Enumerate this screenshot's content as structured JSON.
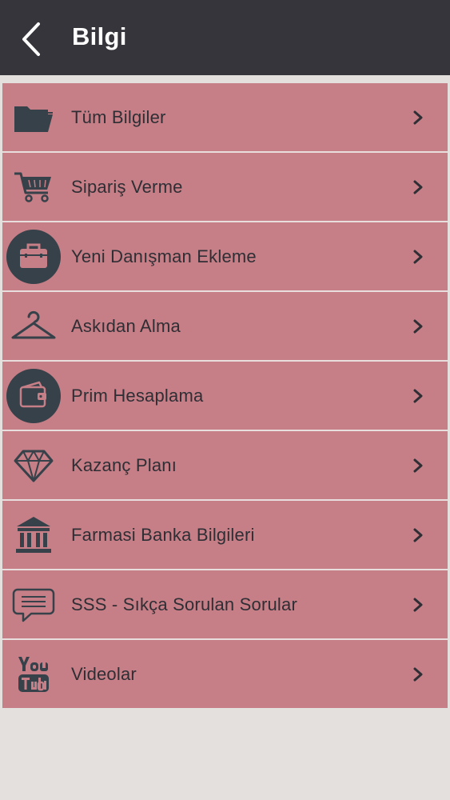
{
  "header": {
    "title": "Bilgi",
    "background": "#36353c"
  },
  "menu": {
    "row_color": "#c67f86",
    "items": [
      {
        "label": "Tüm Bilgiler",
        "icon": "folder-icon"
      },
      {
        "label": "Sipariş Verme",
        "icon": "cart-icon"
      },
      {
        "label": "Yeni Danışman Ekleme",
        "icon": "briefcase-icon"
      },
      {
        "label": "Askıdan Alma",
        "icon": "hanger-icon"
      },
      {
        "label": "Prim Hesaplama",
        "icon": "wallet-icon"
      },
      {
        "label": "Kazanç Planı",
        "icon": "diamond-icon"
      },
      {
        "label": "Farmasi Banka Bilgileri",
        "icon": "bank-icon"
      },
      {
        "label": "SSS - Sıkça Sorulan Sorular",
        "icon": "chat-icon"
      },
      {
        "label": "Videolar",
        "icon": "youtube-icon"
      }
    ]
  }
}
